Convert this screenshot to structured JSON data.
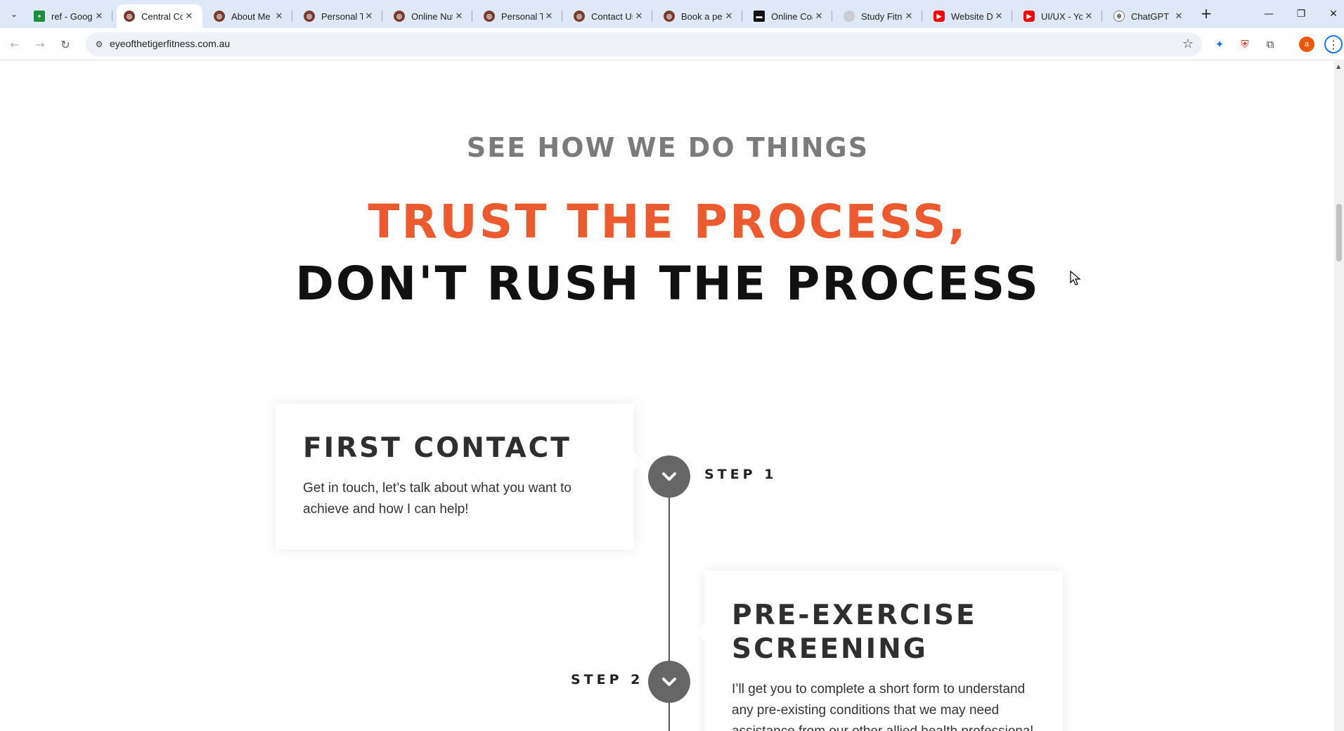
{
  "browser": {
    "tabs": [
      {
        "title": "ref - Google Sheets",
        "favicon": "sheets-icon",
        "color": "#1e8e3e",
        "active": false
      },
      {
        "title": "Central Coast",
        "favicon": "tiger-logo-icon",
        "color": "#7a3b2e",
        "active": true
      },
      {
        "title": "About Me",
        "favicon": "tiger-logo-icon",
        "color": "#7a3b2e",
        "active": false
      },
      {
        "title": "Personal Trainer",
        "favicon": "tiger-logo-icon",
        "color": "#7a3b2e",
        "active": false
      },
      {
        "title": "Online Nutrition",
        "favicon": "tiger-logo-icon",
        "color": "#7a3b2e",
        "active": false
      },
      {
        "title": "Personal Trainer",
        "favicon": "tiger-logo-icon",
        "color": "#7a3b2e",
        "active": false
      },
      {
        "title": "Contact Us",
        "favicon": "tiger-logo-icon",
        "color": "#7a3b2e",
        "active": false
      },
      {
        "title": "Book a personal",
        "favicon": "tiger-logo-icon",
        "color": "#7a3b2e",
        "active": false
      },
      {
        "title": "Online Coaching",
        "favicon": "dark-square-icon",
        "color": "#111111",
        "active": false
      },
      {
        "title": "Study Fitness",
        "favicon": "globe-icon",
        "color": "#9aa0a6",
        "active": false
      },
      {
        "title": "Website Design",
        "favicon": "youtube-icon",
        "color": "#ff0000",
        "active": false
      },
      {
        "title": "UI/UX - YouTube",
        "favicon": "youtube-icon",
        "color": "#ff0000",
        "active": false
      },
      {
        "title": "ChatGPT",
        "favicon": "chatgpt-icon",
        "color": "#444444",
        "active": false
      }
    ],
    "url": "eyeofthetigerfitness.com.au",
    "profile_initial": "a"
  },
  "page": {
    "eyebrow": "SEE HOW WE DO THINGS",
    "headline_accent": "TRUST THE PROCESS,",
    "headline_main": "DON'T RUSH THE PROCESS",
    "steps": [
      {
        "label": "STEP 1",
        "title": "FIRST CONTACT",
        "body": "Get in touch, let’s talk about what you want to achieve and how I can help!"
      },
      {
        "label": "STEP 2",
        "title": "PRE-EXERCISE SCREENING",
        "body": "I’ll get you to complete a short form to understand any pre-existing conditions that we may need assistance from our other allied health professional"
      }
    ]
  },
  "colors": {
    "accent": "#ec5a2f",
    "heading_dark": "#111111",
    "eyebrow_grey": "#7b7b7b",
    "marker_grey": "#666666",
    "tabstrip_bg": "#dfe8f7"
  }
}
